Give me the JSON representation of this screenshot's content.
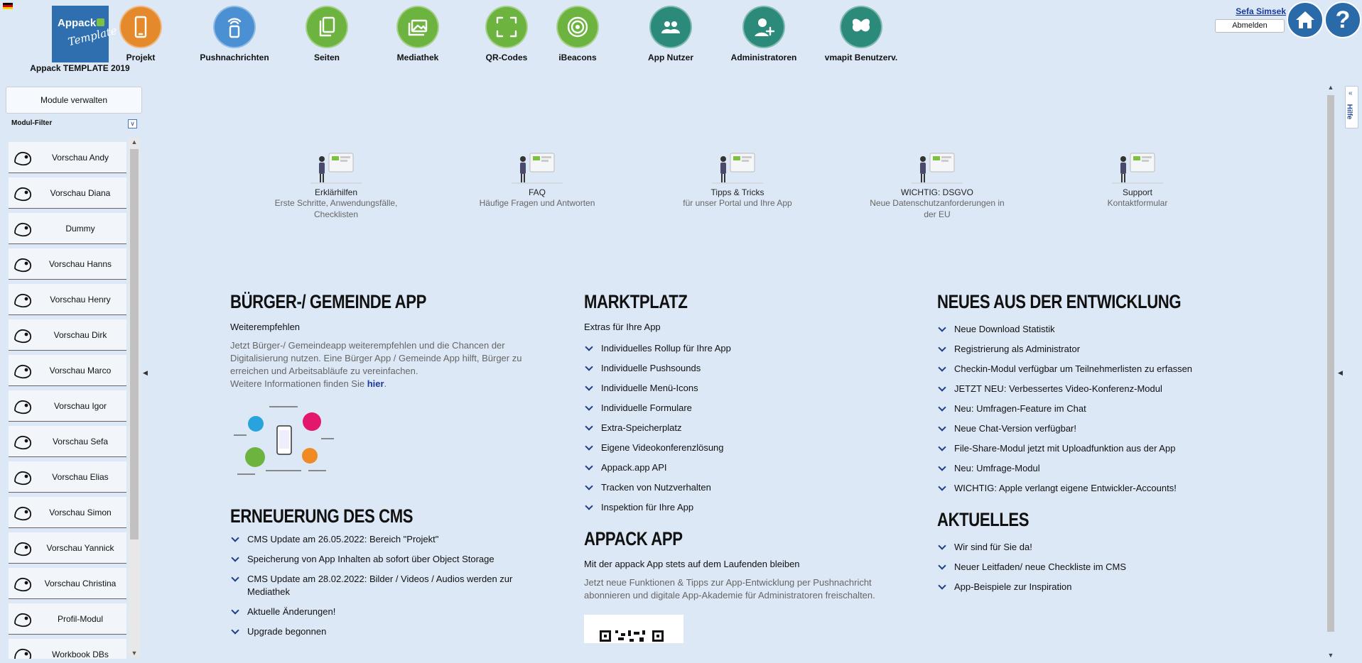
{
  "header": {
    "app_name": "Appack TEMPLATE 2019",
    "logo_text_1": "Appack",
    "logo_text_2": "Template",
    "nav": [
      {
        "label": "Projekt",
        "color": "#e58a2c",
        "icon": "phone-icon"
      },
      {
        "label": "Pushnachrichten",
        "color": "#4a90d2",
        "icon": "push-notification-icon"
      },
      {
        "label": "Seiten",
        "color": "#6cb33f",
        "icon": "pages-icon"
      },
      {
        "label": "Mediathek",
        "color": "#6cb33f",
        "icon": "media-icon"
      },
      {
        "label": "QR-Codes",
        "color": "#6cb33f",
        "icon": "qr-scan-icon"
      },
      {
        "label": "iBeacons",
        "color": "#6cb33f",
        "icon": "beacon-icon"
      },
      {
        "label": "App Nutzer",
        "color": "#2b8a7a",
        "icon": "users-icon"
      },
      {
        "label": "Administratoren",
        "color": "#2b8a7a",
        "icon": "add-admin-icon"
      },
      {
        "label": "vmapit Benutzerv.",
        "color": "#2b8a7a",
        "icon": "butterfly-icon"
      }
    ],
    "user_name": "Sefa Simsek",
    "logout_label": "Abmelden",
    "help_symbol": "?"
  },
  "sidebar": {
    "modules_button": "Module verwalten",
    "filter_label": "Modul-Filter",
    "modules": [
      {
        "label": "Vorschau Andy",
        "icon": "dog-icon"
      },
      {
        "label": "Vorschau Diana",
        "icon": "cat-icon"
      },
      {
        "label": "Dummy",
        "icon": "badge-icon"
      },
      {
        "label": "Vorschau Hanns",
        "icon": "rabbit-icon"
      },
      {
        "label": "Vorschau Henry",
        "icon": "elephant-icon"
      },
      {
        "label": "Vorschau Dirk",
        "icon": "motorbike-icon"
      },
      {
        "label": "Vorschau Marco",
        "icon": "bird-icon"
      },
      {
        "label": "Vorschau Igor",
        "icon": "lion-icon"
      },
      {
        "label": "Vorschau Sefa",
        "icon": "poop-icon"
      },
      {
        "label": "Vorschau Elias",
        "icon": "kiwi-icon"
      },
      {
        "label": "Vorschau Simon",
        "icon": "dizzy-face-icon"
      },
      {
        "label": "Vorschau Yannick",
        "icon": "fire-icon"
      },
      {
        "label": "Vorschau Christina",
        "icon": "pig-icon"
      },
      {
        "label": "Profil-Modul",
        "icon": "profile-icon"
      },
      {
        "label": "Workbook DBs",
        "icon": "gear-icon"
      }
    ]
  },
  "help_tab": "Hilfe",
  "quick_links": [
    {
      "title": "Erklärhilfen",
      "subtitle": "Erste Schritte, Anwendungsfälle, Checklisten"
    },
    {
      "title": "FAQ",
      "subtitle": "Häufige Fragen und Antworten"
    },
    {
      "title": "Tipps & Tricks",
      "subtitle": "für unser Portal und Ihre App"
    },
    {
      "title": "WICHTIG: DSGVO",
      "subtitle": "Neue Datenschutzanforderungen in der EU"
    },
    {
      "title": "Support",
      "subtitle": "Kontaktformular"
    }
  ],
  "col1": {
    "heading": "Bürger-/ Gemeinde App",
    "subheading": "Weiterempfehlen",
    "paragraph": "Jetzt Bürger-/ Gemeindeapp weiterempfehlen und die Chancen der Digitalisierung nutzen. Eine Bürger App / Gemeinde App hilft, Bürger zu erreichen und Arbeitsabläufe zu vereinfachen.",
    "more_text": "Weitere Informationen finden Sie ",
    "more_link": "hier",
    "more_end": ".",
    "cms_heading": "Erneuerung des CMS",
    "cms_items": [
      "CMS Update am 26.05.2022: Bereich \"Projekt\"",
      "Speicherung von App Inhalten ab sofort über Object Storage",
      "CMS Update am 28.02.2022: Bilder / Videos / Audios werden zur Mediathek",
      "Aktuelle Änderungen!",
      "Upgrade begonnen"
    ]
  },
  "col2": {
    "heading": "Marktplatz",
    "subheading": "Extras für Ihre App",
    "items": [
      "Individuelles Rollup für Ihre App",
      "Individuelle Pushsounds",
      "Individuelle Menü-Icons",
      "Individuelle Formulare",
      "Extra-Speicherplatz",
      "Eigene Videokonferenzlösung",
      "Appack.app API",
      "Tracken von Nutzverhalten",
      "Inspektion für Ihre App"
    ],
    "app_heading": "Appack App",
    "app_sub": "Mit der appack App stets auf dem Laufenden bleiben",
    "app_para": "Jetzt neue Funktionen & Tipps zur App-Entwicklung per Pushnachricht abonnieren und digitale App-Akademie für Administratoren freischalten."
  },
  "col3": {
    "heading": "Neues aus der Entwicklung",
    "items": [
      "Neue Download Statistik",
      "Registrierung als Administrator",
      "Checkin-Modul verfügbar um Teilnehmerlisten zu erfassen",
      "JETZT NEU: Verbessertes Video-Konferenz-Modul",
      "Neu: Umfragen-Feature im Chat",
      "Neue Chat-Version verfügbar!",
      "File-Share-Modul jetzt mit Uploadfunktion aus der App",
      "Neu: Umfrage-Modul",
      "WICHTIG: Apple verlangt eigene Entwickler-Accounts!"
    ],
    "news_heading": "Aktuelles",
    "news_items": [
      "Wir sind für Sie da!",
      "Neuer Leitfaden/ neue Checkliste im CMS",
      "App-Beispiele zur Inspiration"
    ]
  }
}
